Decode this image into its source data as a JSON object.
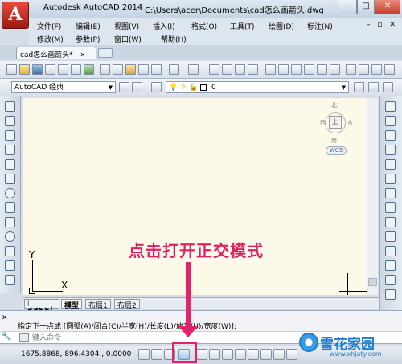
{
  "title": {
    "app_name": "Autodesk AutoCAD 2014",
    "file_path": "C:\\Users\\acer\\Documents\\cad怎么画箭头.dwg",
    "app_button_label": "A"
  },
  "window_controls": {
    "minimize": "–",
    "restore": "□",
    "close": "✕"
  },
  "menu": {
    "row1": [
      "文件(F)",
      "编辑(E)",
      "视图(V)",
      "插入(I)",
      "格式(O)",
      "工具(T)",
      "绘图(D)",
      "标注(N)"
    ],
    "row2": [
      "修改(M)",
      "参数(P)",
      "窗口(W)",
      "帮助(H)"
    ],
    "doc_controls": "– ▫ ✕"
  },
  "document_tab": {
    "label": "cad怎么画箭头*",
    "close": "✕"
  },
  "toolbar2": {
    "workspace_value": "AutoCAD 经典",
    "layer_value": "0"
  },
  "viewcube": {
    "top_label": "上",
    "wcs_label": "WCS",
    "n": "北",
    "s": "南",
    "w": "西",
    "e": "东"
  },
  "ucs": {
    "y_label": "Y",
    "x_label": "X"
  },
  "layout_tabs": [
    "模型",
    "布局1",
    "布局2"
  ],
  "command": {
    "history_line": "指定下一点或 [圆弧(A)/闭合(C)/半宽(H)/长度(L)/放弃(U)/宽度(W)]:",
    "input_placeholder": "键入命令"
  },
  "status": {
    "coordinates": "1675.8868, 896.4304 , 0.0000"
  },
  "annotation": {
    "text": "点击打开正交模式"
  },
  "watermark": {
    "name": "雪花家园",
    "url": "www.xhjaty.com"
  },
  "colors": {
    "accent": "#e2226a",
    "canvas": "#fcf9e8",
    "watermark": "#1c7fd0"
  }
}
